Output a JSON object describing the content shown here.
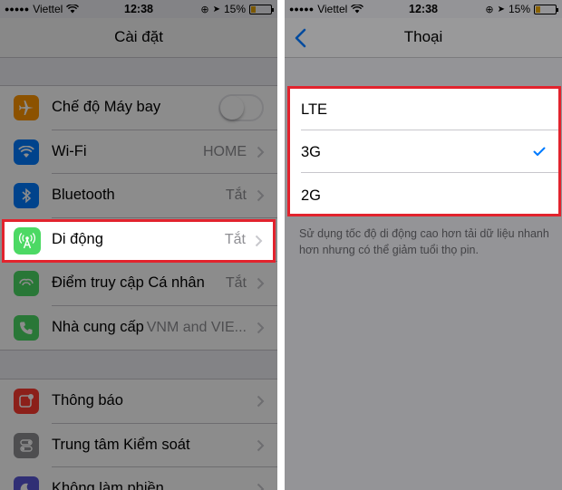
{
  "left": {
    "status": {
      "carrier": "Viettel",
      "time": "12:38",
      "battery": "15%"
    },
    "title": "Cài đặt",
    "group1": [
      {
        "label": "Chế độ Máy bay",
        "icon": "airplane-icon",
        "color": "#ff9500",
        "toggle": false
      },
      {
        "label": "Wi-Fi",
        "detail": "HOME",
        "icon": "wifi-icon",
        "color": "#007aff"
      },
      {
        "label": "Bluetooth",
        "detail": "Tắt",
        "icon": "bluetooth-icon",
        "color": "#007aff"
      },
      {
        "label": "Di động",
        "detail": "Tắt",
        "icon": "cellular-icon",
        "color": "#4cd964"
      },
      {
        "label": "Điểm truy cập Cá nhân",
        "detail": "Tắt",
        "icon": "hotspot-icon",
        "color": "#4cd964"
      },
      {
        "label": "Nhà cung cấp",
        "detail": "VNM and VIE...",
        "icon": "phone-icon",
        "color": "#4cd964"
      }
    ],
    "group2": [
      {
        "label": "Thông báo",
        "icon": "notifications-icon",
        "color": "#ff3b30"
      },
      {
        "label": "Trung tâm Kiểm soát",
        "icon": "control-center-icon",
        "color": "#8e8e93"
      },
      {
        "label": "Không làm phiền",
        "icon": "moon-icon",
        "color": "#5856d6"
      }
    ]
  },
  "right": {
    "status": {
      "carrier": "Viettel",
      "time": "12:38",
      "battery": "15%"
    },
    "title": "Thoại",
    "options": [
      {
        "label": "LTE",
        "checked": false
      },
      {
        "label": "3G",
        "checked": true
      },
      {
        "label": "2G",
        "checked": false
      }
    ],
    "note": "Sử dụng tốc độ di động cao hơn tải dữ liệu nhanh hơn nhưng có thể giảm tuổi thọ pin."
  },
  "colors": {
    "highlight": "#e2232d",
    "accent": "#007aff"
  }
}
